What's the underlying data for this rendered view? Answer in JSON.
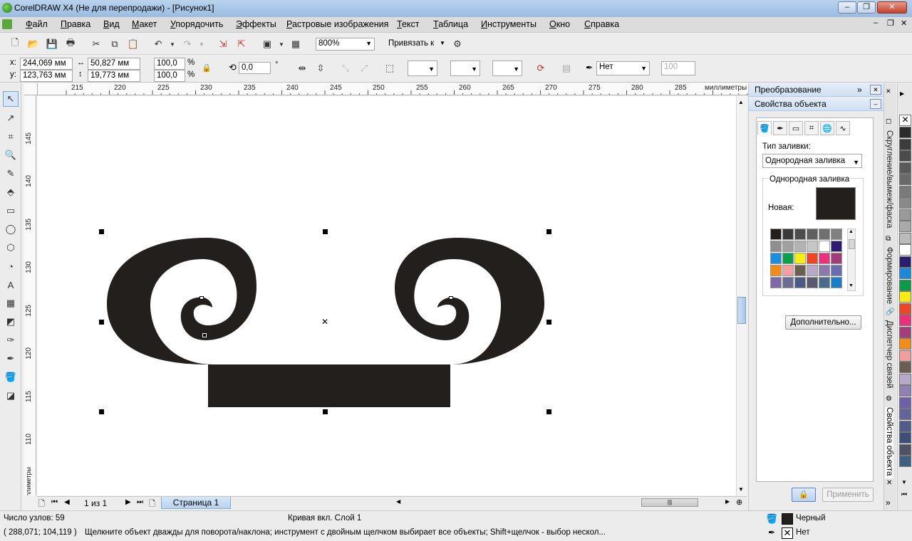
{
  "window": {
    "title": "CorelDRAW X4 (Не для перепродажи) - [Рисунок1]",
    "min_label": "–",
    "max_label": "❐",
    "close_label": "✕"
  },
  "menu": [
    "Файл",
    "Правка",
    "Вид",
    "Макет",
    "Упорядочить",
    "Эффекты",
    "Растровые изображения",
    "Текст",
    "Таблица",
    "Инструменты",
    "Окно",
    "Справка"
  ],
  "toolbar": {
    "zoom": "800%",
    "snap_label": "Привязать к"
  },
  "propbar": {
    "x_label": "x:",
    "x_value": "244,069 мм",
    "y_label": "y:",
    "y_value": "123,763 мм",
    "w_value": "50,827 мм",
    "h_value": "19,773 мм",
    "scale_x": "100,0",
    "scale_y": "100,0",
    "percent": "%",
    "angle": "0,0",
    "degree": "°",
    "outline": "Нет",
    "opacity": "100"
  },
  "rulers": {
    "units": "миллиметры",
    "h_ticks": [
      "215",
      "220",
      "225",
      "230",
      "235",
      "240",
      "245",
      "250",
      "255",
      "260",
      "265",
      "270",
      "275",
      "280",
      "285"
    ],
    "v_ticks": [
      "145",
      "140",
      "135",
      "130",
      "125",
      "120",
      "115",
      "110"
    ]
  },
  "page_nav": {
    "page_count": "1 из 1",
    "page_tab": "Страница 1"
  },
  "docker": {
    "transform_title": "Преобразование",
    "props_title": "Свойства объекта",
    "fill_type_label": "Тип заливки:",
    "fill_type_value": "Однородная заливка",
    "group_title": "Однородная заливка",
    "new_label": "Новая:",
    "new_color": "#231f1c",
    "more_button": "Дополнительно...",
    "apply_button": "Применить",
    "swatches": [
      "#231f1c",
      "#3a3a3a",
      "#4d4d4d",
      "#5f5f5f",
      "#707070",
      "#808080",
      "#8f8f8f",
      "#a0a0a0",
      "#b3b3b3",
      "#c6c6c6",
      "#ffffff",
      "#2e1a70",
      "#1b8ee0",
      "#0aa04b",
      "#f7ee12",
      "#ef4523",
      "#ee2f7b",
      "#a23c78",
      "#f48a18",
      "#f4a0a0",
      "#6d5e54",
      "#b8a8c8",
      "#8c7aae",
      "#6a6cb4",
      "#7d6aaa",
      "#6c6c94",
      "#4e5a86",
      "#5a5a70",
      "#4c6a8a",
      "#1c7ec8"
    ]
  },
  "side_tabs": [
    "Скругление/вымеж/фаска",
    "Формирование",
    "Диспетчер связей",
    "Свойства объекта"
  ],
  "palette": [
    "#2b2b2b",
    "#3c3c3c",
    "#4b4b4b",
    "#5a5a5a",
    "#6a6a6a",
    "#7a7a7a",
    "#8a8a8a",
    "#9a9a9a",
    "#aaaaaa",
    "#bbbbbb",
    "#ffffff",
    "#2a1d6e",
    "#1a8ad8",
    "#0b9b48",
    "#f6eb14",
    "#ee4524",
    "#ed2e79",
    "#a33e7a",
    "#f28c1a",
    "#f29f9c",
    "#6c5d52",
    "#b8a9c9",
    "#9081b2",
    "#6f5fa6",
    "#66629a",
    "#4e5c8c",
    "#3f4e78",
    "#505066",
    "#3d5f82"
  ],
  "status": {
    "nodes": "Число узлов: 59",
    "object": "Кривая вкл. Слой 1",
    "coords": "( 288,071; 104,119 )",
    "hint": "Щелкните объект дважды для поворота/наклона; инструмент с двойным щелчком выбирает все объекты; Shift+щелчок - выбор нескол...",
    "fill_name": "Черный",
    "fill_color": "#231f1c",
    "outline_name": "Нет"
  },
  "shape_color": "#231f1c"
}
